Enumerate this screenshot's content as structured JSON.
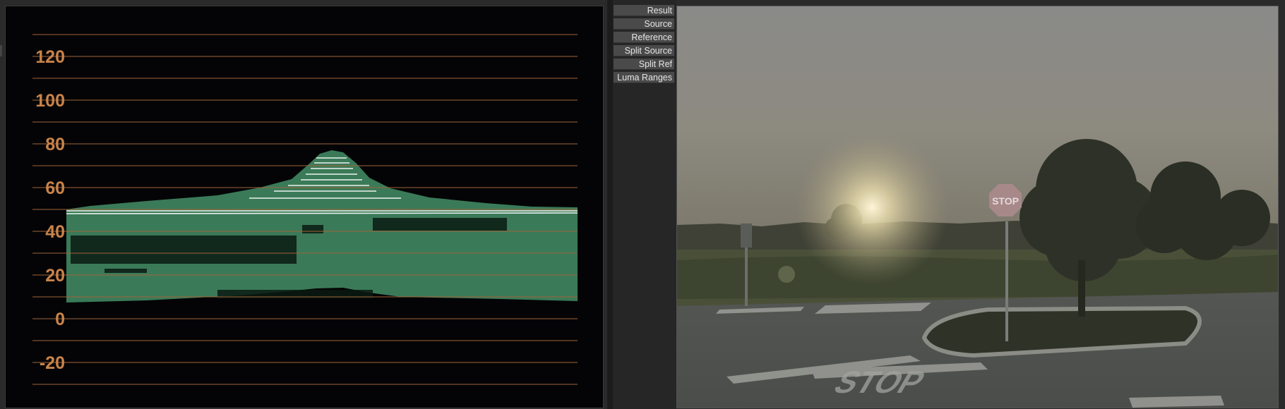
{
  "waveform": {
    "scale_labels": [
      "120",
      "100",
      "80",
      "60",
      "40",
      "20",
      "0",
      "-20"
    ],
    "scale_color": "#c8834a",
    "trace_color": "#3a7a58",
    "highlight_color": "#ffffff"
  },
  "view_modes": [
    {
      "key": "result",
      "label": "Result"
    },
    {
      "key": "source",
      "label": "Source"
    },
    {
      "key": "reference",
      "label": "Reference"
    },
    {
      "key": "split_source",
      "label": "Split Source"
    },
    {
      "key": "split_ref",
      "label": "Split Ref"
    },
    {
      "key": "luma_ranges",
      "label": "Luma Ranges"
    }
  ],
  "viewer": {
    "stop_sign_text": "STOP",
    "road_marking_text": "STOP"
  }
}
